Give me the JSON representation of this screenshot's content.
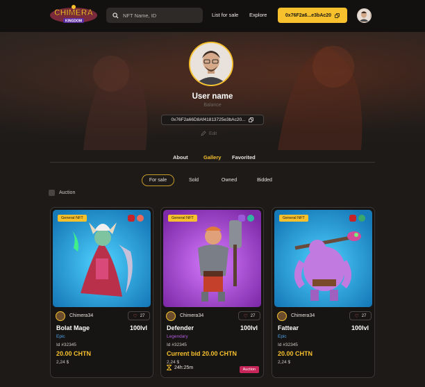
{
  "header": {
    "logo_text": "Chimera Kingdom",
    "search_placeholder": "NFT Name, ID",
    "nav_list": "List for sale",
    "nav_explore": "Explore",
    "wallet_short": "0x76F2a6...e3bAc20"
  },
  "profile": {
    "username": "User name",
    "balance_label": "Balance",
    "address": "0x76F2a66D8Af41813725e3bAc20...",
    "edit_label": "Edit"
  },
  "tabs": [
    {
      "label": "About",
      "active": false
    },
    {
      "label": "Gallery",
      "active": true
    },
    {
      "label": "Favorited",
      "active": false
    }
  ],
  "filters": [
    {
      "label": "For sale",
      "active": true
    },
    {
      "label": "Sold",
      "active": false
    },
    {
      "label": "Owned",
      "active": false
    },
    {
      "label": "Bidded",
      "active": false
    }
  ],
  "auction_filter_label": "Auction",
  "cards": [
    {
      "badge": "General NFT",
      "owner": "Chimera34",
      "likes": "27",
      "name": "Bolat Mage",
      "level": "100lvl",
      "rarity": "Epic",
      "rarity_color": "#4ea1e8",
      "id": "Id #32345",
      "price": "20.00 CHTN",
      "usd": "2,24 $",
      "art_color": "#36b8e8"
    },
    {
      "badge": "General NFT",
      "owner": "Chimera34",
      "likes": "27",
      "name": "Defender",
      "level": "100lvl",
      "rarity": "Legendary",
      "rarity_color": "#b05ad9",
      "id": "Id #32345",
      "price": "Current bid 20.00 CHTN",
      "usd": "2,24 $",
      "timer": "24h:25m",
      "auction_tag": "Auction",
      "art_color": "#a53ad6"
    },
    {
      "badge": "General NFT",
      "owner": "Chimera34",
      "likes": "27",
      "name": "Fattear",
      "level": "100lvl",
      "rarity": "Epic",
      "rarity_color": "#4ea1e8",
      "id": "Id #32345",
      "price": "20.00 CHTN",
      "usd": "2,24 $",
      "art_color": "#36b8e8"
    }
  ]
}
